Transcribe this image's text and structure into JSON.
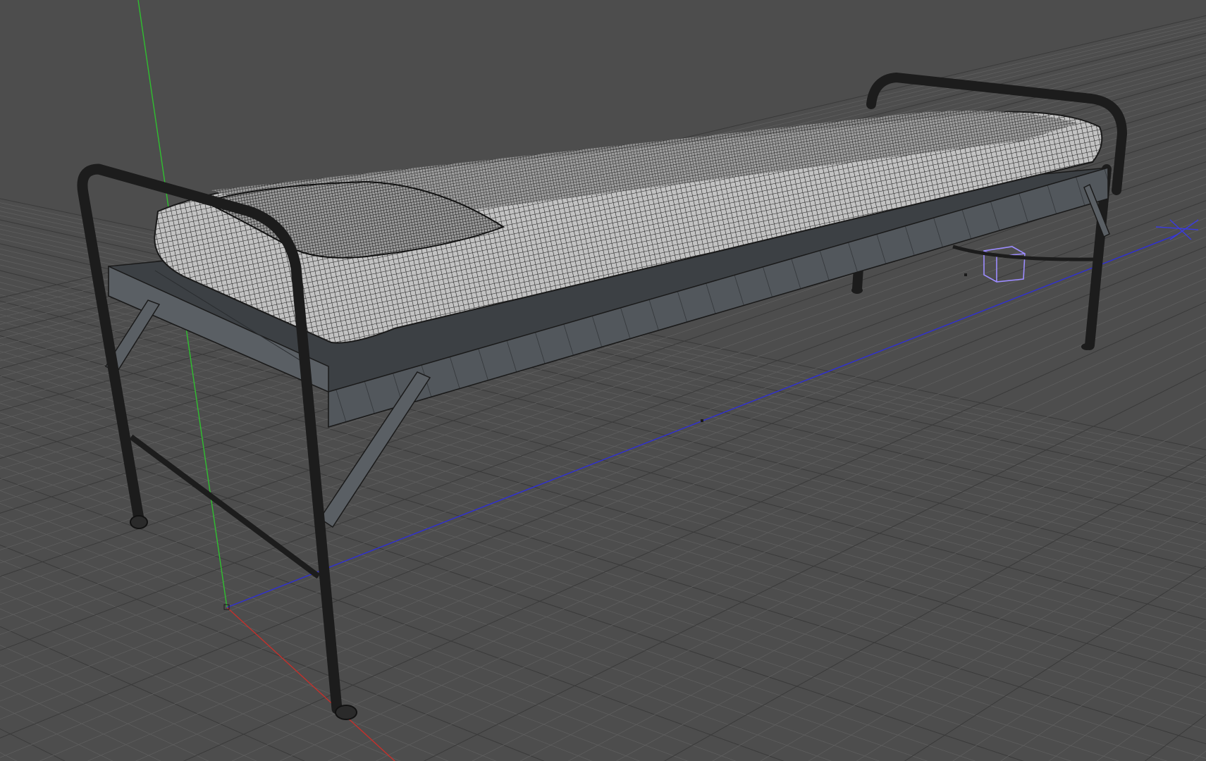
{
  "app": {
    "window_type": "3d-viewport",
    "view_mode": "perspective",
    "shading": "wireframe-on-shaded"
  },
  "scene": {
    "objects": [
      {
        "name_hint": "bed-frame",
        "kind": "metal-tube-frame"
      },
      {
        "name_hint": "mattress",
        "kind": "subdivided-mesh"
      },
      {
        "name_hint": "pillow",
        "kind": "subdivided-mesh"
      },
      {
        "name_hint": "light-gizmo",
        "kind": "wire-box"
      }
    ],
    "grid": true
  },
  "colors": {
    "background": "#4d4d4d",
    "grid_line": "#5e5e5e",
    "grid_major": "#3a3a3a",
    "axis_x": "#c4302b",
    "axis_y": "#2fbf2f",
    "axis_z": "#2f2fd4",
    "frame_metal": "#1c1c1c",
    "rail": "#4e5358",
    "mattress_fill": "#bdbdbd",
    "mesh_wire": "#1a1a1a",
    "gizmo": "#9c8cff"
  },
  "icons": [
    "origin-gizmo-icon",
    "light-gizmo-icon"
  ]
}
